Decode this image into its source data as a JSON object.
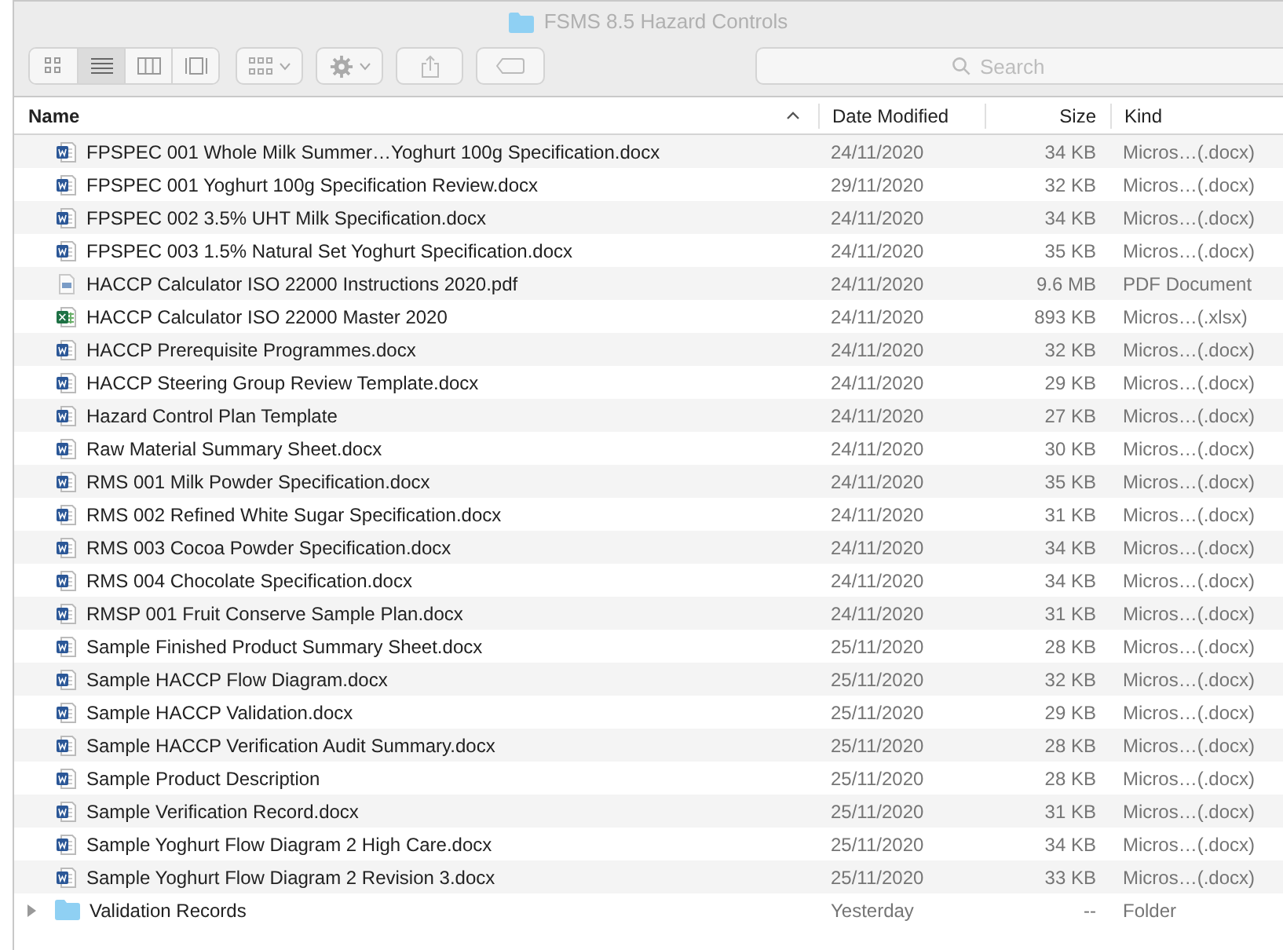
{
  "window": {
    "title": "FSMS 8.5 Hazard Controls"
  },
  "toolbar": {
    "view_modes": [
      {
        "kind": "icons",
        "selected": false
      },
      {
        "kind": "list",
        "selected": true
      },
      {
        "kind": "columns",
        "selected": false
      },
      {
        "kind": "gallery",
        "selected": false
      }
    ],
    "search": {
      "placeholder": "Search"
    }
  },
  "table": {
    "columns": [
      "Name",
      "Date Modified",
      "Size",
      "Kind"
    ],
    "rows": [
      {
        "kind": "word",
        "name": "FPSPEC 001 Whole Milk Summer…Yoghurt 100g Specification.docx",
        "date": "24/11/2020",
        "size": "34 KB",
        "type": "Micros…(.docx)"
      },
      {
        "kind": "word",
        "name": "FPSPEC 001 Yoghurt 100g Specification Review.docx",
        "date": "29/11/2020",
        "size": "32 KB",
        "type": "Micros…(.docx)"
      },
      {
        "kind": "word",
        "name": "FPSPEC 002 3.5% UHT Milk Specification.docx",
        "date": "24/11/2020",
        "size": "34 KB",
        "type": "Micros…(.docx)"
      },
      {
        "kind": "word",
        "name": "FPSPEC 003 1.5% Natural Set Yoghurt Specification.docx",
        "date": "24/11/2020",
        "size": "35 KB",
        "type": "Micros…(.docx)"
      },
      {
        "kind": "pdf",
        "name": "HACCP Calculator ISO 22000 Instructions 2020.pdf",
        "date": "24/11/2020",
        "size": "9.6 MB",
        "type": "PDF Document"
      },
      {
        "kind": "excel",
        "name": "HACCP Calculator ISO 22000 Master 2020",
        "date": "24/11/2020",
        "size": "893 KB",
        "type": "Micros…(.xlsx)"
      },
      {
        "kind": "word",
        "name": "HACCP Prerequisite Programmes.docx",
        "date": "24/11/2020",
        "size": "32 KB",
        "type": "Micros…(.docx)"
      },
      {
        "kind": "word",
        "name": "HACCP Steering Group Review Template.docx",
        "date": "24/11/2020",
        "size": "29 KB",
        "type": "Micros…(.docx)"
      },
      {
        "kind": "word",
        "name": "Hazard Control Plan Template",
        "date": "24/11/2020",
        "size": "27 KB",
        "type": "Micros…(.docx)"
      },
      {
        "kind": "word",
        "name": "Raw Material Summary Sheet.docx",
        "date": "24/11/2020",
        "size": "30 KB",
        "type": "Micros…(.docx)"
      },
      {
        "kind": "word",
        "name": "RMS 001 Milk Powder Specification.docx",
        "date": "24/11/2020",
        "size": "35 KB",
        "type": "Micros…(.docx)"
      },
      {
        "kind": "word",
        "name": "RMS 002 Refined White Sugar Specification.docx",
        "date": "24/11/2020",
        "size": "31 KB",
        "type": "Micros…(.docx)"
      },
      {
        "kind": "word",
        "name": "RMS 003 Cocoa Powder Specification.docx",
        "date": "24/11/2020",
        "size": "34 KB",
        "type": "Micros…(.docx)"
      },
      {
        "kind": "word",
        "name": "RMS 004 Chocolate Specification.docx",
        "date": "24/11/2020",
        "size": "34 KB",
        "type": "Micros…(.docx)"
      },
      {
        "kind": "word",
        "name": "RMSP 001 Fruit Conserve Sample Plan.docx",
        "date": "24/11/2020",
        "size": "31 KB",
        "type": "Micros…(.docx)"
      },
      {
        "kind": "word",
        "name": "Sample Finished Product Summary Sheet.docx",
        "date": "25/11/2020",
        "size": "28 KB",
        "type": "Micros…(.docx)"
      },
      {
        "kind": "word",
        "name": "Sample HACCP Flow Diagram.docx",
        "date": "25/11/2020",
        "size": "32 KB",
        "type": "Micros…(.docx)"
      },
      {
        "kind": "word",
        "name": "Sample HACCP Validation.docx",
        "date": "25/11/2020",
        "size": "29 KB",
        "type": "Micros…(.docx)"
      },
      {
        "kind": "word",
        "name": "Sample HACCP Verification Audit Summary.docx",
        "date": "25/11/2020",
        "size": "28 KB",
        "type": "Micros…(.docx)"
      },
      {
        "kind": "word",
        "name": "Sample Product Description",
        "date": "25/11/2020",
        "size": "28 KB",
        "type": "Micros…(.docx)"
      },
      {
        "kind": "word",
        "name": "Sample Verification Record.docx",
        "date": "25/11/2020",
        "size": "31 KB",
        "type": "Micros…(.docx)"
      },
      {
        "kind": "word",
        "name": "Sample Yoghurt Flow Diagram 2 High Care.docx",
        "date": "25/11/2020",
        "size": "34 KB",
        "type": "Micros…(.docx)"
      },
      {
        "kind": "word",
        "name": "Sample Yoghurt Flow Diagram 2 Revision 3.docx",
        "date": "25/11/2020",
        "size": "33 KB",
        "type": "Micros…(.docx)"
      },
      {
        "kind": "folder",
        "expanded": false,
        "name": "Validation Records",
        "date": "Yesterday",
        "size": "--",
        "type": "Folder"
      }
    ]
  }
}
